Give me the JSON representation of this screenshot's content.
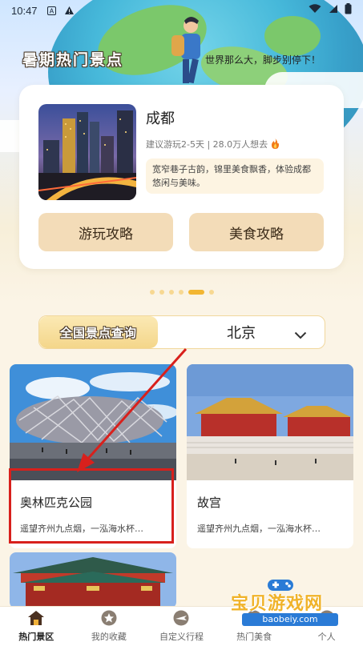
{
  "status_bar": {
    "time": "10:47"
  },
  "header": {
    "title": "暑期热门景点",
    "slogan": "世界那么大，脚步别停下！"
  },
  "featured": {
    "name": "成都",
    "meta": "建议游玩2-5天 | 28.0万人想去",
    "description": "宽窄巷子古韵，锦里美食飘香，体验成都悠闲与美味。",
    "buttons": {
      "play_guide": "游玩攻略",
      "food_guide": "美食攻略"
    }
  },
  "pager": {
    "count": 6,
    "active_index": 4
  },
  "city_query": {
    "label": "全国景点查询",
    "selected_city": "北京"
  },
  "spots": [
    {
      "name": "奥林匹克公园",
      "description": "遥望齐州九点烟，一泓海水杯…"
    },
    {
      "name": "故宫",
      "description": "遥望齐州九点烟，一泓海水杯…"
    }
  ],
  "nav": {
    "items": [
      {
        "label": "热门景区",
        "icon": "home-icon"
      },
      {
        "label": "我的收藏",
        "icon": "star-icon"
      },
      {
        "label": "自定义行程",
        "icon": "plane-icon"
      },
      {
        "label": "热门美食",
        "icon": "food-icon"
      },
      {
        "label": "个人",
        "icon": "person-icon"
      }
    ]
  },
  "watermark": {
    "title": "宝贝游戏网",
    "url": "baobeiy.com"
  },
  "colors": {
    "accent": "#f2b632",
    "button_bg": "#f3dcb8",
    "highlight": "#d8201c"
  }
}
